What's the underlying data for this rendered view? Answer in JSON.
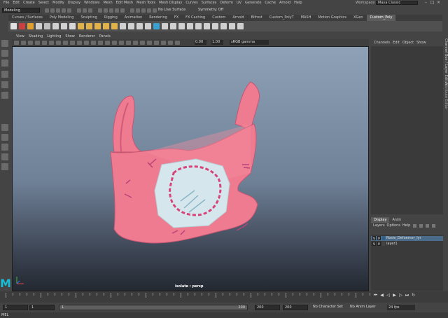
{
  "menubar": {
    "items": [
      "File",
      "Edit",
      "Create",
      "Select",
      "Modify",
      "Display",
      "Windows",
      "Mesh",
      "Edit Mesh",
      "Mesh Tools",
      "Mesh Display",
      "Curves",
      "Surfaces",
      "Deform",
      "UV",
      "Generate",
      "Cache",
      "Arnold",
      "Help"
    ],
    "workspace_label": "Workspace :",
    "workspace_value": "Maya Classic"
  },
  "statusline": {
    "mode": "Modeling",
    "live_surface": "No Live Surface",
    "symmetry": "Symmetry: Off"
  },
  "shelf": {
    "tabs": [
      "Curves / Surfaces",
      "Poly Modeling",
      "Sculpting",
      "Rigging",
      "Animation",
      "Rendering",
      "FX",
      "FX Caching",
      "Custom",
      "Arnold",
      "Bifrost",
      "Custom_PolyT",
      "MASH",
      "Motion Graphics",
      "XGen",
      "Custom_Poly"
    ],
    "active_tab": "Custom_Poly",
    "icon_colors": [
      "#e0e0e0",
      "#c84040",
      "#e0a030",
      "#d0d0d0",
      "#c0c0c0",
      "#d0d0d0",
      "#d0d0d0",
      "#d8d8d8",
      "#e2b24a",
      "#e2b24a",
      "#e2b24a",
      "#e2b24a",
      "#e2b24a",
      "#d0d0d0",
      "#d0d0d0",
      "#d0d0d0",
      "#d0d0d0",
      "#3aa0d0",
      "#d0d0d0",
      "#d0d0d0",
      "#d0d0d0",
      "#d0d0d0",
      "#d0d0d0",
      "#d0d0d0",
      "#d0d0d0",
      "#d0d0d0",
      "#d0d0d0",
      "#d0d0d0"
    ]
  },
  "viewport": {
    "menu": [
      "View",
      "Shading",
      "Lighting",
      "Show",
      "Renderer",
      "Panels"
    ],
    "field_a": "0.00",
    "field_b": "1.00",
    "colorspace": "sRGB gamma",
    "camera_label": "isolate : persp"
  },
  "channelbox": {
    "menu": [
      "Channels",
      "Edit",
      "Object",
      "Show"
    ],
    "side_tabs": [
      "Channel Box / Layer Editor",
      "Attribute Editor"
    ]
  },
  "layers": {
    "tabs": [
      "Display",
      "Anim"
    ],
    "active_tab": "Display",
    "menu": [
      "Layers",
      "Options",
      "Help"
    ],
    "rows": [
      {
        "v": "V",
        "p": "P",
        "name": "Rosie_Defoemer_lyr",
        "color": "#2d5f87",
        "selected": true
      },
      {
        "v": "V",
        "p": "P",
        "name": "layer1",
        "color": "#444444",
        "selected": false
      }
    ]
  },
  "timeline": {
    "labels": []
  },
  "range": {
    "start": "1",
    "current": "1",
    "slider_start": "1",
    "range_end": "200",
    "end": "200",
    "anim_end": "200",
    "character_set": "No Character Set",
    "anim_layer": "No Anim Layer",
    "fps": "24 fps"
  },
  "cmdline": {
    "mel": "MEL"
  },
  "logo": "M",
  "colors": {
    "shirt_pink": "#ee7b8f",
    "shirt_shadow": "#d05a77",
    "patch": "#d5e6ec",
    "viewport_top": "#8ea1b7",
    "viewport_bottom": "#232830"
  }
}
